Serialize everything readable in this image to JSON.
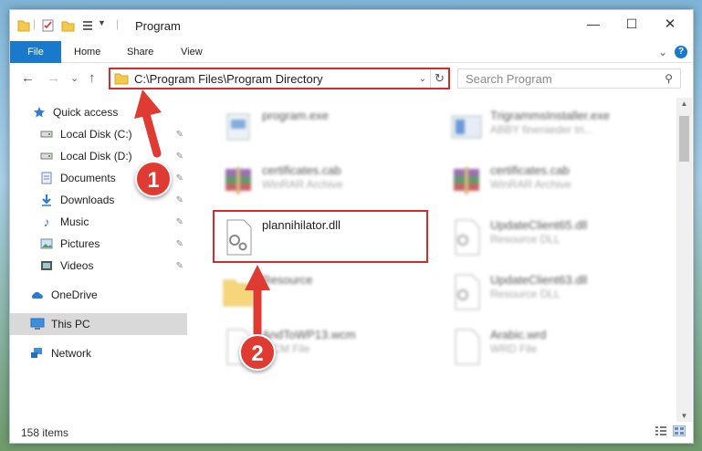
{
  "window": {
    "title": "Program",
    "minimize_glyph": "—",
    "maximize_glyph": "☐",
    "close_glyph": "✕"
  },
  "ribbon": {
    "tabs": [
      "File",
      "Home",
      "Share",
      "View"
    ],
    "help_label": "?",
    "expand_glyph": "⌄"
  },
  "nav": {
    "back_glyph": "←",
    "forward_glyph": "→",
    "recent_glyph": "⌄",
    "up_glyph": "↑"
  },
  "address": {
    "path": "C:\\Program Files\\Program Directory",
    "dropdown_glyph": "⌄",
    "refresh_glyph": "↻"
  },
  "search": {
    "placeholder": "Search Program",
    "icon_glyph": "⚲"
  },
  "sidebar": {
    "items": [
      {
        "label": "Quick access",
        "icon": "star-icon",
        "pinned": false
      },
      {
        "label": "Local Disk (C:)",
        "icon": "drive-icon",
        "pinned": true
      },
      {
        "label": "Local Disk (D:)",
        "icon": "drive-icon",
        "pinned": true
      },
      {
        "label": "Documents",
        "icon": "documents-icon",
        "pinned": true
      },
      {
        "label": "Downloads",
        "icon": "download-icon",
        "pinned": true
      },
      {
        "label": "Music",
        "icon": "music-icon",
        "pinned": true
      },
      {
        "label": "Pictures",
        "icon": "pictures-icon",
        "pinned": true
      },
      {
        "label": "Videos",
        "icon": "videos-icon",
        "pinned": true
      },
      {
        "label": "OneDrive",
        "icon": "cloud-icon",
        "pinned": false
      },
      {
        "label": "This PC",
        "icon": "computer-icon",
        "pinned": false,
        "selected": true
      },
      {
        "label": "Network",
        "icon": "network-icon",
        "pinned": false
      }
    ],
    "pin_glyph": "📌"
  },
  "files": [
    {
      "name": "program.exe",
      "type": "",
      "icon": "exe-icon",
      "blurred": true
    },
    {
      "name": "TrigrammsInstaller.exe",
      "type": "ABBY fineraeder tri...",
      "icon": "installer-icon",
      "blurred": true
    },
    {
      "name": "certificates.cab",
      "type": "WinRAR Archive",
      "icon": "archive-icon",
      "blurred": true
    },
    {
      "name": "certificates.cab",
      "type": "WinRAR Archive",
      "icon": "archive-icon",
      "blurred": true
    },
    {
      "name": "plannihilator.dll",
      "type": "",
      "icon": "dll-icon",
      "blurred": false
    },
    {
      "name": "UpdateClient65.dll",
      "type": "Resource DLL",
      "icon": "dll-icon",
      "blurred": true
    },
    {
      "name": "Resource",
      "type": "",
      "icon": "folder-icon",
      "blurred": true
    },
    {
      "name": "UpdateClient63.dll",
      "type": "Resource DLL",
      "icon": "dll-icon",
      "blurred": true
    },
    {
      "name": "AndToWP13.wcm",
      "type": "WCM File",
      "icon": "file-icon",
      "blurred": true
    },
    {
      "name": "Arabic.wrd",
      "type": "WRD File",
      "icon": "file-icon",
      "blurred": true
    }
  ],
  "status": {
    "item_count": "158 items"
  },
  "annotations": {
    "marker_1": "1",
    "marker_2": "2",
    "color": "#d52b2b"
  },
  "colors": {
    "accent": "#1979ca",
    "highlight": "#d52b2b",
    "marker": "#e03b32"
  }
}
